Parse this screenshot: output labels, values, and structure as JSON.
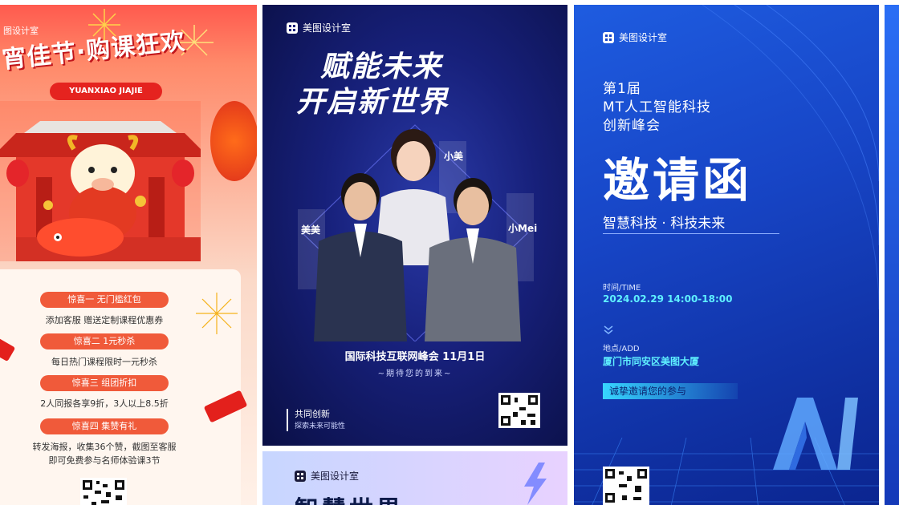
{
  "poster_festival": {
    "brand": "图设计室",
    "title": "宵佳节·购课狂欢",
    "pinyin": "YUANXIAO JIAJIE",
    "offers": [
      {
        "label": "惊喜一 无门槛红包",
        "desc": "添加客服 赠送定制课程优惠券"
      },
      {
        "label": "惊喜二 1元秒杀",
        "desc": "每日热门课程限时一元秒杀"
      },
      {
        "label": "惊喜三 组团折扣",
        "desc": "2人同报各享9折，3人以上8.5折"
      },
      {
        "label": "惊喜四 集赞有礼",
        "desc": "转发海报，收集36个赞，截图至客服"
      }
    ],
    "desc_extra": "即可免费参与名师体验课3节"
  },
  "poster_summit": {
    "brand": "美图设计室",
    "headline_1": "赋能未来",
    "headline_2": "开启新世界",
    "name_left": "美美",
    "name_top": "小美",
    "name_right": "小Mei",
    "event": "国际科技互联网峰会 11月1日",
    "await": "~期待您的到来~",
    "co_title": "共同创新",
    "co_sub": "探索未来可能性"
  },
  "poster_partial": {
    "brand": "美图设计室",
    "headline": "智慧世界"
  },
  "poster_invite": {
    "brand": "美图设计室",
    "edition": "第1届",
    "name_line1": "MT人工智能科技",
    "name_line2": "创新峰会",
    "title": "邀请函",
    "slogan": "智慧科技 · 科技未来",
    "time_label": "时间/TIME",
    "time_value": "2024.02.29 14:00-18:00",
    "addr_label": "地点/ADD",
    "addr_value": "厦门市同安区美图大厦",
    "sincere": "诚挚邀请您的参与",
    "ai_mark": "AI"
  },
  "colors": {
    "festival_red": "#e5231f",
    "summit_navy": "#17207a",
    "invite_blue": "#1745c6",
    "accent_cyan": "#5ff0ff"
  }
}
